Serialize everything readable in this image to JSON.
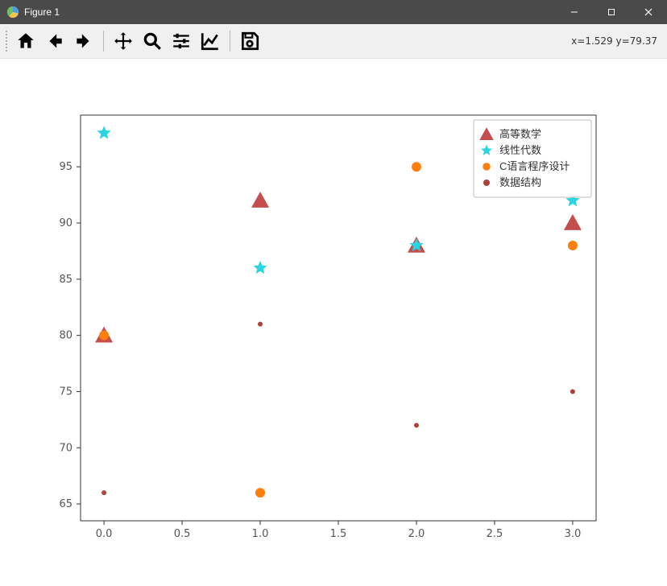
{
  "window": {
    "title": "Figure 1",
    "buttons": {
      "min": "–",
      "max": "☐",
      "close": "✕"
    }
  },
  "toolbar": {
    "home": "home-icon",
    "back": "back-icon",
    "forward": "forward-icon",
    "pan": "pan-icon",
    "zoom": "zoom-icon",
    "subplots": "subplots-icon",
    "axes": "axes-icon",
    "save": "save-icon"
  },
  "cursor_readout": "x=1.529 y=79.37",
  "chart_data": {
    "type": "scatter",
    "x": [
      0,
      1,
      2,
      3
    ],
    "series": [
      {
        "name": "高等数学",
        "values": [
          80,
          92,
          88,
          90
        ],
        "color": "#c44d4d",
        "marker": "triangle",
        "size": 10
      },
      {
        "name": "线性代数",
        "values": [
          98,
          86,
          88,
          92
        ],
        "color": "#2ad4e0",
        "marker": "star",
        "size": 9
      },
      {
        "name": "C语言程序设计",
        "values": [
          80,
          66,
          95,
          88
        ],
        "color": "#ff7f0e",
        "marker": "circle",
        "size": 6
      },
      {
        "name": "数据结构",
        "values": [
          66,
          81,
          72,
          75
        ],
        "color": "#b0403a",
        "marker": "smallcircle",
        "size": 3
      }
    ],
    "xticks": [
      "0.0",
      "0.5",
      "1.0",
      "1.5",
      "2.0",
      "2.5",
      "3.0"
    ],
    "xtick_vals": [
      0,
      0.5,
      1,
      1.5,
      2,
      2.5,
      3
    ],
    "yticks": [
      "65",
      "70",
      "75",
      "80",
      "85",
      "90",
      "95"
    ],
    "ytick_vals": [
      65,
      70,
      75,
      80,
      85,
      90,
      95
    ],
    "xlim": [
      -0.15,
      3.15
    ],
    "ylim": [
      63.5,
      99.6
    ],
    "title": "",
    "xlabel": "",
    "ylabel": ""
  }
}
